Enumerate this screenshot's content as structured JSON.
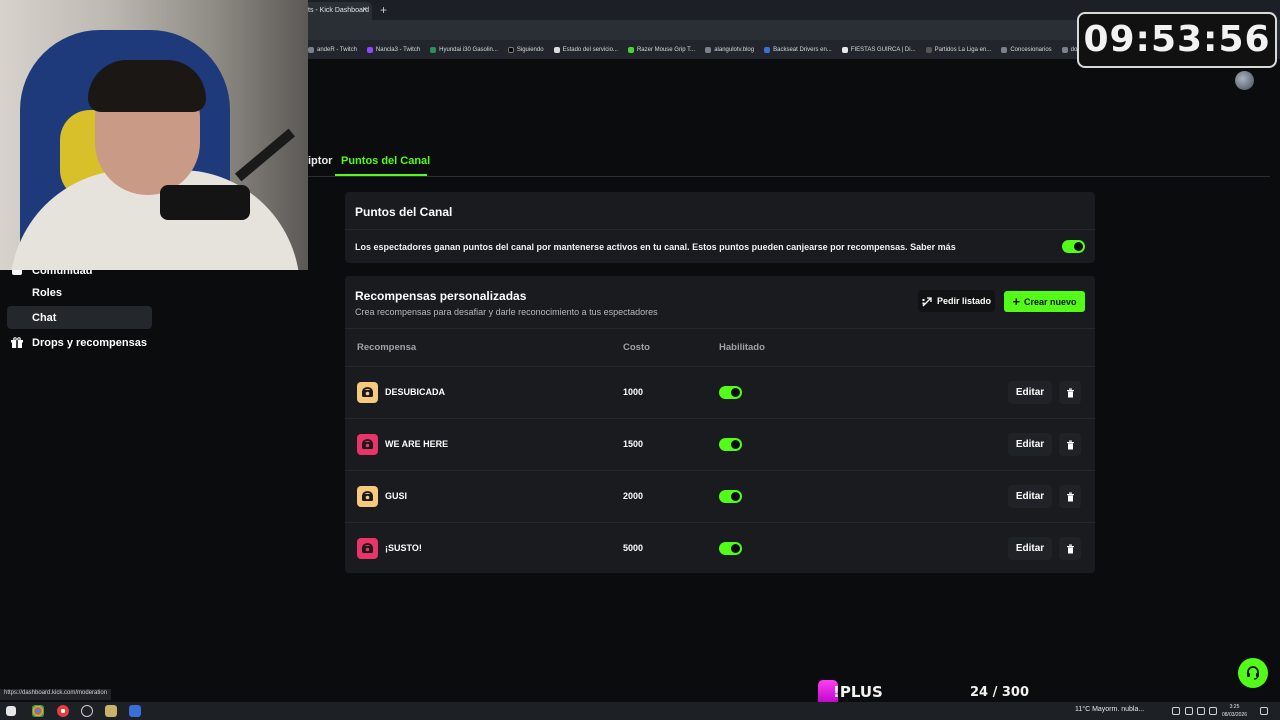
{
  "browser": {
    "tab_title": "ts - Kick Dashboard",
    "tab_close": "×",
    "new_tab": "+",
    "bookmarks": [
      "andeR - Twitch",
      "Nancla3 - Twitch",
      "Hyundai i30 Gasolin...",
      "Siguiendo",
      "Estado del servicio...",
      "Razer Mouse Grip T...",
      "alangulotv.blog",
      "Backseat Drivers en...",
      "FIESTAS GUIRCA | Di...",
      "Partidos La Liga en...",
      "Concesionarios",
      "dolares"
    ],
    "status_url": "https://dashboard.kick.com/moderation"
  },
  "overlay": {
    "timer": "09:53:56",
    "plus_label": "!PLUS",
    "sub_count": "24 / 300"
  },
  "sidebar": {
    "partial_item": "Comunidad",
    "items": [
      {
        "label": "Roles"
      },
      {
        "label": "Chat"
      },
      {
        "label": "Drops y recompensas"
      }
    ]
  },
  "tabs": {
    "partial": "iptor",
    "active": "Puntos del Canal"
  },
  "channel_points": {
    "title": "Puntos del Canal",
    "description": "Los espectadores ganan puntos del canal por mantenerse activos en tu canal. Estos puntos pueden canjearse por recompensas. Saber más",
    "enabled": true
  },
  "rewards": {
    "title": "Recompensas personalizadas",
    "subtitle": "Crea recompensas para desafiar y darle reconocimiento a tus espectadores",
    "request_list_label": "Pedir listado",
    "create_label": "Crear nuevo",
    "columns": {
      "reward": "Recompensa",
      "cost": "Costo",
      "enabled": "Habilitado"
    },
    "edit_label": "Editar",
    "items": [
      {
        "name": "DESUBICADA",
        "cost": "1000",
        "enabled": true,
        "color": "#f7c97e"
      },
      {
        "name": "WE ARE HERE",
        "cost": "1500",
        "enabled": true,
        "color": "#e8336b"
      },
      {
        "name": "GUSI",
        "cost": "2000",
        "enabled": true,
        "color": "#f7c97e"
      },
      {
        "name": "¡SUSTO!",
        "cost": "5000",
        "enabled": true,
        "color": "#e8336b"
      }
    ]
  },
  "taskbar": {
    "weather": "11°C  Mayorm. nubla...",
    "time": "3:25",
    "date": "08/03/2026"
  },
  "colors": {
    "accent": "#53fc18",
    "background": "#0b0c0d",
    "card": "#191b1f"
  }
}
